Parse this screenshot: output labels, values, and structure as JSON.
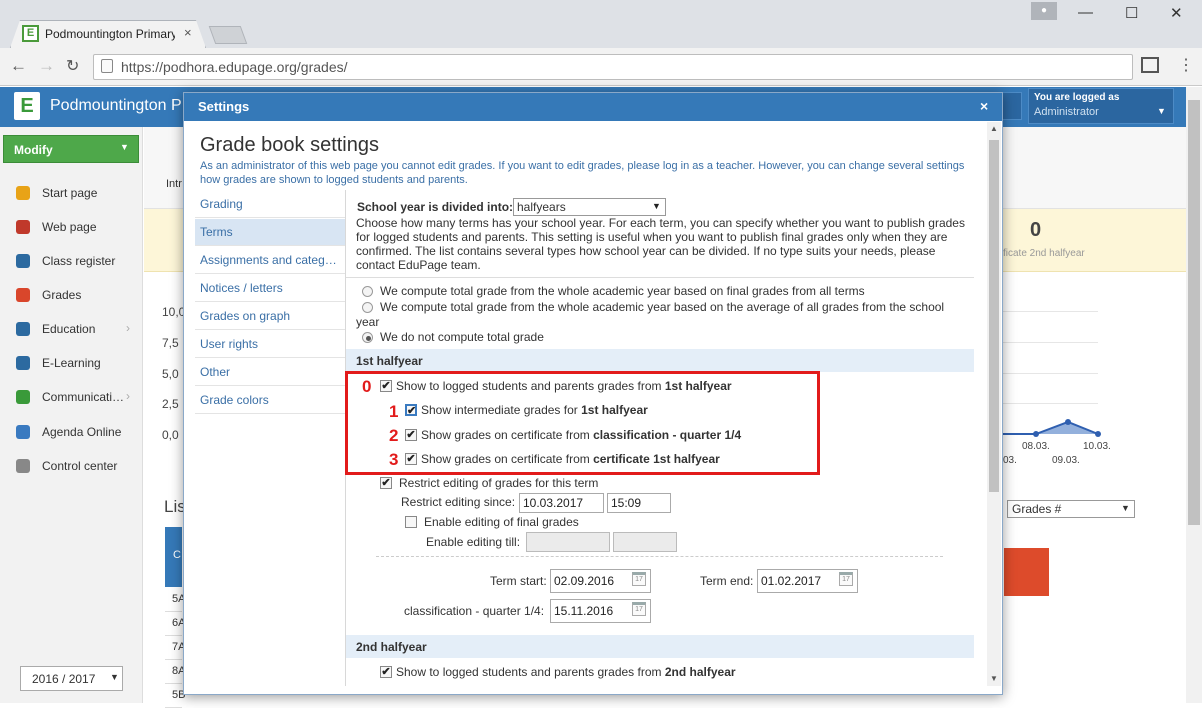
{
  "browser": {
    "tab_title": "Podmountington Primary",
    "tab_close": "×",
    "url": "https://podhora.edupage.org/grades/",
    "win_min": "—",
    "win_max": "☐",
    "win_close": "✕",
    "back": "←",
    "forward": "→",
    "reload": "↻",
    "menu": "⋮"
  },
  "app": {
    "logo_letter": "E",
    "school_name": "Podmountington P",
    "logged_line1": "You are logged as",
    "logged_line2": "Administrator"
  },
  "sidebar": {
    "modify_label": "Modify",
    "items": [
      {
        "label": "Start page",
        "icon": "star-icon",
        "color": "#e8a317"
      },
      {
        "label": "Web page",
        "icon": "web-icon",
        "color": "#c0392b"
      },
      {
        "label": "Class register",
        "icon": "book-icon",
        "color": "#2c6aa0"
      },
      {
        "label": "Grades",
        "icon": "grades-icon",
        "color": "#d9462b"
      },
      {
        "label": "Education",
        "icon": "education-icon",
        "color": "#2c6aa0"
      },
      {
        "label": "E-Learning",
        "icon": "elearning-icon",
        "color": "#2c6aa0"
      },
      {
        "label": "Communicati…",
        "icon": "communication-icon",
        "color": "#3a9a3a"
      },
      {
        "label": "Agenda Online",
        "icon": "agenda-icon",
        "color": "#3a7ac0"
      },
      {
        "label": "Control center",
        "icon": "control-icon",
        "color": "#888888"
      }
    ],
    "year": "2016 / 2017"
  },
  "background": {
    "intr": "Intr",
    "stat_value": "0",
    "stat_label": "ficate 2nd halfyear",
    "y_ticks": [
      "10,0",
      "7,5",
      "5,0",
      "2,5",
      "0,0"
    ],
    "x_dates": [
      "08.03.",
      "10.03.",
      "03.",
      "09.03."
    ],
    "list_title": "Lis",
    "grade_select": "Grades #",
    "table_head": "C",
    "rows": [
      "5A",
      "6A",
      "7A",
      "8A",
      "5B"
    ]
  },
  "modal": {
    "title": "Settings",
    "close": "×",
    "heading": "Grade book settings",
    "note": "As an administrator of this web page you cannot edit grades. If you want to edit grades, please log in as a teacher. However, you can change several settings how grades are shown to logged students and parents.",
    "nav": [
      "Grading",
      "Terms",
      "Assignments and categ…",
      "Notices / letters",
      "Grades on graph",
      "User rights",
      "Other",
      "Grade colors"
    ],
    "division_label": "School year is divided into:",
    "division_value": "halfyears",
    "division_desc": "Choose how many terms has your school year. For each term, you can specify whether you want to publish grades for logged students and parents. This setting is useful when you want to publish final grades only when they are confirmed. The list contains several types how school year can be divided. If no type suits your needs, please contact EduPage team.",
    "radio1": "We compute total grade from the whole academic year based on final grades from all terms",
    "radio2": "We compute total grade from the whole academic year based on the average of all grades from the school year",
    "radio3": "We do not compute total grade",
    "section1": "1st halfyear",
    "num0": "0",
    "num1": "1",
    "num2": "2",
    "num3": "3",
    "opt0_pre": "Show to logged students and parents grades from ",
    "opt0_bold": "1st halfyear",
    "opt1_pre": "Show intermediate grades for ",
    "opt1_bold": "1st halfyear",
    "opt2_pre": "Show grades on certificate from ",
    "opt2_bold": "classification - quarter 1/4",
    "opt3_pre": "Show grades on certificate from ",
    "opt3_bold": "certificate 1st halfyear",
    "restrict_label": "Restrict editing of grades for this term",
    "restrict_since_label": "Restrict editing since:",
    "restrict_date": "10.03.2017",
    "restrict_time": "15:09",
    "enable_final_label": "Enable editing of final grades",
    "enable_till_label": "Enable editing till:",
    "term_start_label": "Term start:",
    "term_start": "02.09.2016",
    "term_end_label": "Term end:",
    "term_end": "01.02.2017",
    "quarter_label": "classification - quarter 1/4:",
    "quarter_date": "15.11.2016",
    "section2": "2nd halfyear",
    "opt4_pre": "Show to logged students and parents grades from ",
    "opt4_bold": "2nd halfyear"
  }
}
